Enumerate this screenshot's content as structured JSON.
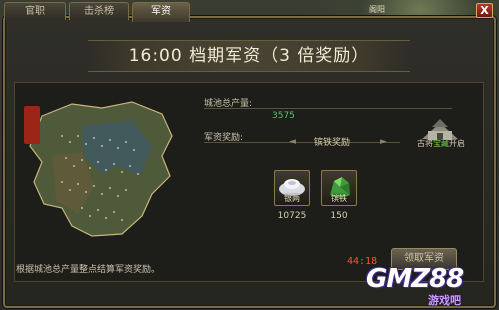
{
  "tabs": [
    {
      "label": "官职",
      "active": false
    },
    {
      "label": "击杀榜",
      "active": false
    },
    {
      "label": "军资",
      "active": true
    }
  ],
  "close_label": "X",
  "scene_label": "阁阳",
  "title": "16:00 档期军资（3 倍奖励）",
  "map_seal": "",
  "city_output_label": "城池总产量:",
  "city_output_value": "3575",
  "reward_label": "军资奖励:",
  "reward_type": "镔铁奖励",
  "fort_label_prefix": "古将",
  "fort_label_highlight": "宝藏",
  "fort_label_suffix": "开启",
  "items": [
    {
      "name": "银两",
      "count": "10725",
      "icon": "silver-ingot-icon"
    },
    {
      "name": "镔铁",
      "count": "150",
      "icon": "green-ore-icon"
    }
  ],
  "bottom_note": "根据城池总产量整点结算军资奖励。",
  "timer": "44:18",
  "claim_button_label": "领取军资",
  "watermark_main": "GMZ88",
  "watermark_sub": "游戏吧",
  "colors": {
    "accent_gold": "#7b6a45",
    "value_green": "#5cc36a",
    "timer_red": "#ff4d3a"
  }
}
